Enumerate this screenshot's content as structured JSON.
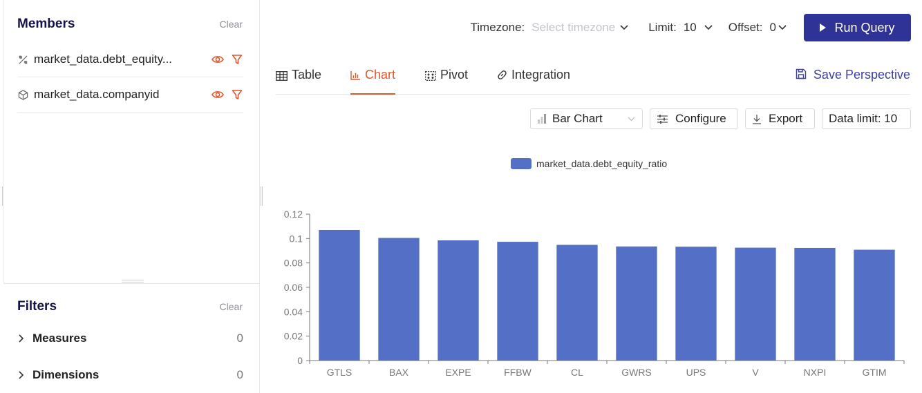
{
  "members": {
    "title": "Members",
    "clear_label": "Clear",
    "items": [
      {
        "label": "market_data.debt_equity...",
        "icon": "measure-icon"
      },
      {
        "label": "market_data.companyid",
        "icon": "cube-icon"
      }
    ]
  },
  "filters": {
    "title": "Filters",
    "clear_label": "Clear",
    "items": [
      {
        "label": "Measures",
        "count": "0"
      },
      {
        "label": "Dimensions",
        "count": "0"
      }
    ]
  },
  "toolbar": {
    "timezone_label": "Timezone:",
    "timezone_placeholder": "Select timezone",
    "limit_label": "Limit:",
    "limit_value": "10",
    "offset_label": "Offset:",
    "offset_value": "0",
    "run_label": "Run Query"
  },
  "tabs": [
    {
      "label": "Table",
      "icon": "table-icon"
    },
    {
      "label": "Chart",
      "icon": "bar-chart-icon"
    },
    {
      "label": "Pivot",
      "icon": "pivot-icon"
    },
    {
      "label": "Integration",
      "icon": "link-icon"
    }
  ],
  "active_tab": "Chart",
  "save_perspective_label": "Save Perspective",
  "chart_toolbar": {
    "chart_type": "Bar Chart",
    "configure_label": "Configure",
    "export_label": "Export",
    "data_limit_label": "Data limit: 10"
  },
  "colors": {
    "accent": "#e0562d",
    "primary": "#2f3395",
    "bar": "#5470c6"
  },
  "chart_data": {
    "type": "bar",
    "categories": [
      "GTLS",
      "BAX",
      "EXPE",
      "FFBW",
      "CL",
      "GWRS",
      "UPS",
      "V",
      "NXPI",
      "GTIM"
    ],
    "series": [
      {
        "name": "market_data.debt_equity_ratio",
        "values": [
          0.107,
          0.1005,
          0.0985,
          0.0973,
          0.0948,
          0.0935,
          0.0933,
          0.0925,
          0.0923,
          0.0908
        ]
      }
    ],
    "ylim": [
      0,
      0.12
    ],
    "yticks": [
      "0",
      "0.02",
      "0.04",
      "0.06",
      "0.08",
      "0.1",
      "0.12"
    ],
    "legend": "top-center",
    "grid": false
  }
}
